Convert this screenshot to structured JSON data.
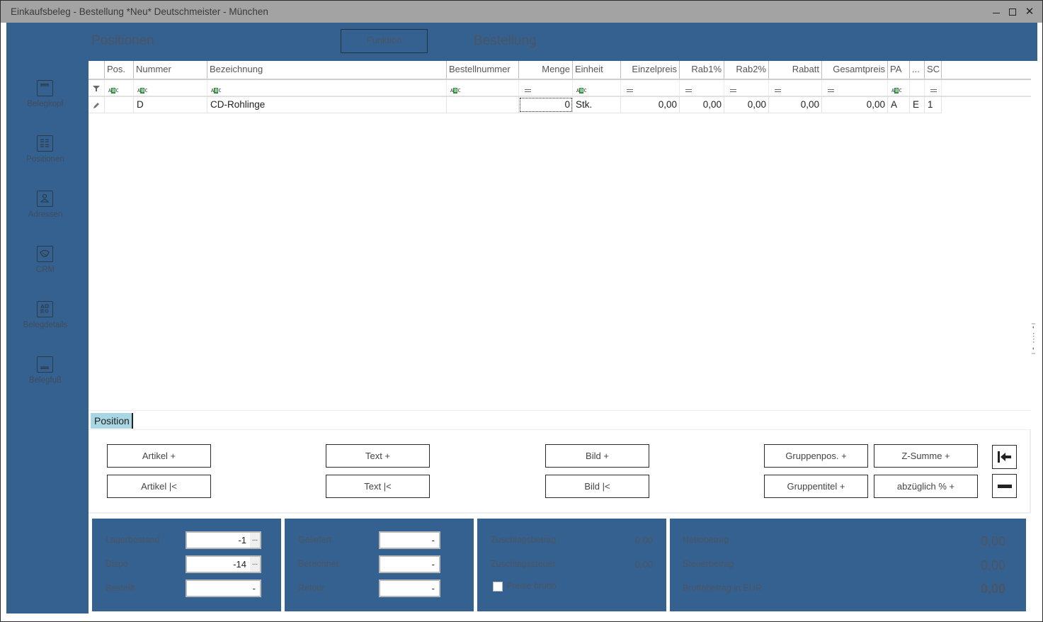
{
  "window": {
    "title": "Einkaufsbeleg - Bestellung *Neu* Deutschmeister - München",
    "controls": {
      "minimize": "minimize",
      "maximize": "maximize",
      "close": "close"
    }
  },
  "header": {
    "section_title": "Positionen",
    "function_button": "Funktion",
    "document_type": "Bestellung"
  },
  "sidebar": {
    "items": [
      {
        "label": "Belegkopf",
        "icon": "document-header-icon"
      },
      {
        "label": "Positionen",
        "icon": "positions-grid-icon"
      },
      {
        "label": "Adressen",
        "icon": "person-icon"
      },
      {
        "label": "CRM",
        "icon": "handshake-icon"
      },
      {
        "label": "Belegdetails",
        "icon": "details-shapes-icon"
      },
      {
        "label": "Belegfuß",
        "icon": "document-footer-icon"
      }
    ]
  },
  "grid": {
    "columns": [
      {
        "key": "pos",
        "label": "Pos.",
        "filter": "text"
      },
      {
        "key": "nummer",
        "label": "Nummer",
        "filter": "text"
      },
      {
        "key": "bezeichnung",
        "label": "Bezeichnung",
        "filter": "text"
      },
      {
        "key": "bestellnummer",
        "label": "Bestellnummer",
        "filter": "text"
      },
      {
        "key": "menge",
        "label": "Menge",
        "filter": "equals"
      },
      {
        "key": "einheit",
        "label": "Einheit",
        "filter": "text"
      },
      {
        "key": "einzelpreis",
        "label": "Einzelpreis",
        "filter": "equals"
      },
      {
        "key": "rab1",
        "label": "Rab1%",
        "filter": "equals"
      },
      {
        "key": "rab2",
        "label": "Rab2%",
        "filter": "equals"
      },
      {
        "key": "rabatt",
        "label": "Rabatt",
        "filter": "equals"
      },
      {
        "key": "gesamtpreis",
        "label": "Gesamtpreis",
        "filter": "equals"
      },
      {
        "key": "pa",
        "label": "PA",
        "filter": "text"
      },
      {
        "key": "more",
        "label": "...",
        "filter": "none"
      },
      {
        "key": "sc",
        "label": "SC",
        "filter": "equals"
      }
    ],
    "filter_text_glyph": "ABC",
    "rows": [
      {
        "pos": "",
        "nummer": "D",
        "bezeichnung": "CD-Rohlinge",
        "bestellnummer": "",
        "menge": "0",
        "einheit": "Stk.",
        "einzelpreis": "0,00",
        "rab1": "0,00",
        "rab2": "0,00",
        "rabatt": "0,00",
        "gesamtpreis": "0,00",
        "pa": "A",
        "more": "E",
        "sc": "1"
      }
    ]
  },
  "position_panel": {
    "tab_label": "Position",
    "buttons": {
      "artikel_add": "Artikel +",
      "artikel_insert": "Artikel |<",
      "text_add": "Text +",
      "text_insert": "Text |<",
      "bild_add": "Bild +",
      "bild_insert": "Bild |<",
      "gruppenpos_add": "Gruppenpos. +",
      "gruppentitel_add": "Gruppentitel +",
      "zsumme_add": "Z-Summe +",
      "abzueglich_add": "abzüglich % +"
    }
  },
  "stock": {
    "lagerbestand": {
      "label": "Lagerbestand",
      "value": "-1",
      "more": "..."
    },
    "dispo": {
      "label": "Dispo",
      "value": "-14",
      "more": "..."
    },
    "bestellt": {
      "label": "Bestellt",
      "value": "-"
    }
  },
  "delivery": {
    "geliefert": {
      "label": "Geliefert",
      "value": "-"
    },
    "berechnet": {
      "label": "Berechnet",
      "value": "-"
    },
    "retour": {
      "label": "Retour",
      "value": "-"
    }
  },
  "surcharge": {
    "zuschlagsbetrag": {
      "label": "Zuschlagsbetrag",
      "value": "0,00"
    },
    "zuschlagssteuer": {
      "label": "Zuschlagssteuer",
      "value": "0,00"
    },
    "preise_brutto": {
      "label": "Preise brutto",
      "checked": false
    }
  },
  "totals": {
    "netto": {
      "label": "Nettobetrag",
      "value": "0,00"
    },
    "steuer": {
      "label": "Steuerbetrag",
      "value": "0,00"
    },
    "brutto": {
      "label": "Bruttobetrag in EUR",
      "value": "0,00"
    }
  }
}
